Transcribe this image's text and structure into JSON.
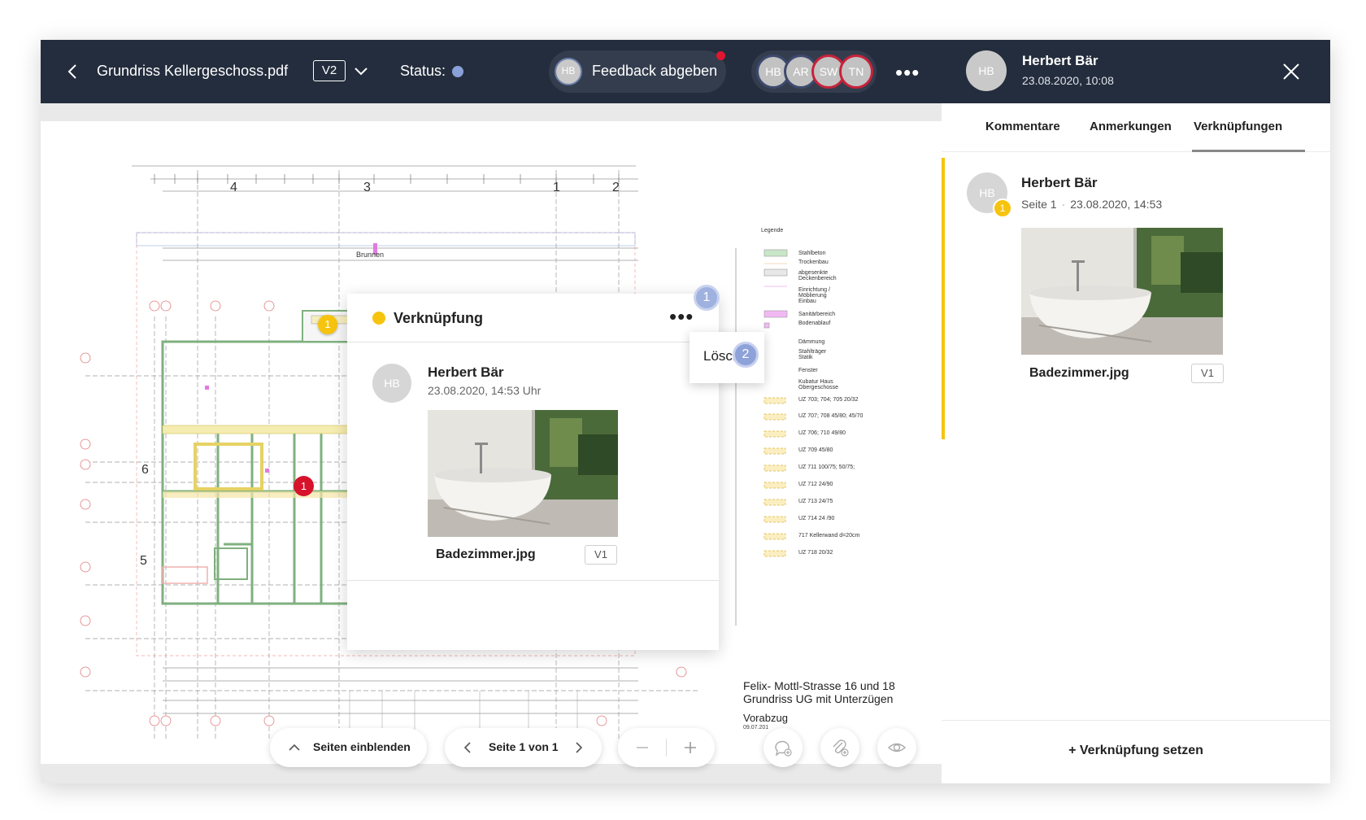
{
  "topbar": {
    "filename": "Grundriss Kellergeschoss.pdf",
    "version": "V2",
    "status_label": "Status:",
    "status_color": "#8aa0d8",
    "feedback_avatar": "HB",
    "feedback_label": "Feedback abgeben",
    "participants": [
      "HB",
      "AR",
      "SW",
      "TN"
    ]
  },
  "plan": {
    "axis_numbers_top": [
      "4",
      "3",
      "1",
      "2"
    ],
    "axis_numbers_left": [
      "6",
      "5"
    ],
    "label_brunnen": "Brunnen",
    "legend_title": "Legende",
    "legend_items": [
      "Stahlbeton",
      "Trockenbau",
      "abgesenkte Deckenbereich",
      "Einrichtung / Möblierung Einbau",
      "Sanitärbereich",
      "Bodenablauf",
      "Dämmung",
      "Stahlträger Statik",
      "Fenster",
      "Kubatur Haus Obergeschosse"
    ],
    "uz_items": [
      "UZ 703; 704; 705   20/32",
      "UZ 707; 708   45/80; 45/70",
      "UZ 706; 710   49/80",
      "UZ 709   45/80",
      "UZ 711   100/75; 50/75;",
      "UZ 712   24/90",
      "UZ 713   24/75",
      "UZ 714   24 /90",
      "717  Kellerwand d=20cm",
      "UZ 718   20/32"
    ],
    "address_line1": "Felix- Mottl-Strasse 16 und 18",
    "address_line2": "Grundriss UG mit Unterzügen",
    "vorabzug": "Vorabzug",
    "vorabzug_date": "09.07.201",
    "marker_yellow": "1",
    "marker_red": "1"
  },
  "popup": {
    "title": "Verknüpfung",
    "author_initials": "HB",
    "author": "Herbert Bär",
    "date": "23.08.2020, 14:53 Uhr",
    "file_name": "Badezimmer.jpg",
    "file_version": "V1",
    "step_badge_1": "1",
    "step_badge_2": "2",
    "menu_item_delete": "Lösch"
  },
  "bottom": {
    "pages_toggle": "Seiten einblenden",
    "page_indicator": "Seite 1 von 1"
  },
  "panel": {
    "header_initials": "HB",
    "header_name": "Herbert Bär",
    "header_date": "23.08.2020, 10:08",
    "tabs": [
      "Kommentare",
      "Anmerkungen",
      "Verknüpfungen"
    ],
    "active_tab": "Verknüpfungen",
    "card": {
      "initials": "HB",
      "number": "1",
      "name": "Herbert Bär",
      "page": "Seite 1",
      "date": "23.08.2020, 14:53",
      "file_name": "Badezimmer.jpg",
      "file_version": "V1"
    },
    "add_link_label": "+ Verknüpfung setzen"
  },
  "colors": {
    "topbar": "#242d3d",
    "accent_yellow": "#f6c40e",
    "marker_red": "#d7132b",
    "badge_blue": "#8ea2da"
  }
}
